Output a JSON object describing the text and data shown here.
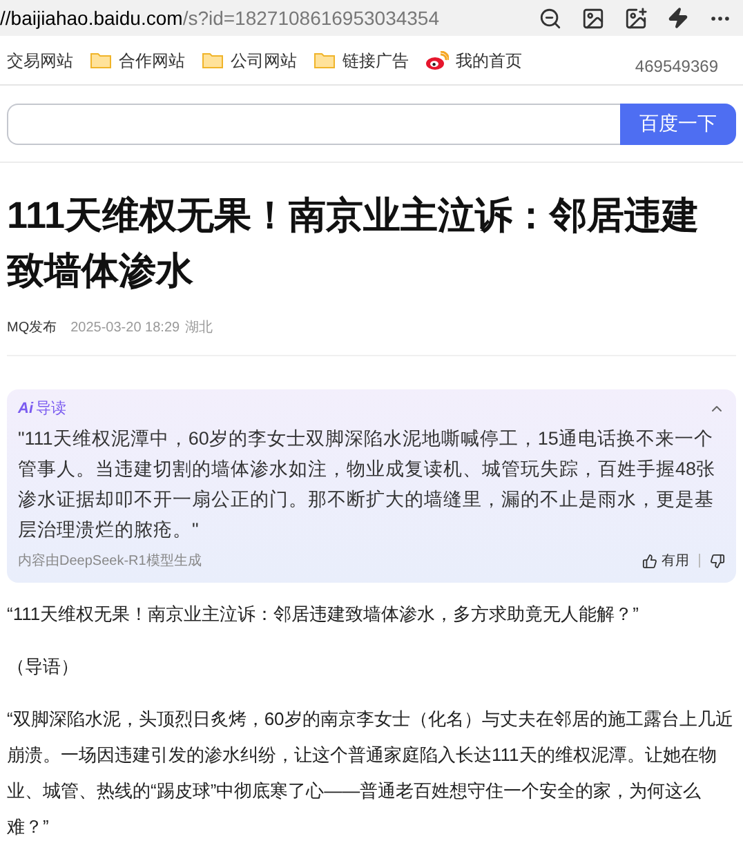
{
  "address_bar": {
    "url_host": "//baijiahao.baidu.com",
    "url_path": "/s?id=1827108616953034354"
  },
  "bookmarks": [
    {
      "kind": "text",
      "label": "交易网站"
    },
    {
      "kind": "folder",
      "label": "合作网站"
    },
    {
      "kind": "folder",
      "label": "公司网站"
    },
    {
      "kind": "folder",
      "label": "链接广告"
    },
    {
      "kind": "weibo",
      "label": "我的首页"
    }
  ],
  "bookmark_counter": "469549369",
  "search": {
    "button": "百度一下"
  },
  "article": {
    "title": "111天维权无果！南京业主泣诉：邻居违建致墙体渗水",
    "author": "MQ发布",
    "date": "2025-03-20 18:29",
    "location": "湖北"
  },
  "ai_summary": {
    "badge": "Ai",
    "label": "导读",
    "expanded": true,
    "text": "\"111天维权泥潭中，60岁的李女士双脚深陷水泥地嘶喊停工，15通电话换不来一个管事人。当违建切割的墙体渗水如注，物业成复读机、城管玩失踪，百姓手握48张渗水证据却叩不开一扇公正的门。那不断扩大的墙缝里，漏的不止是雨水，更是基层治理溃烂的脓疮。\"",
    "source": "内容由DeepSeek-R1模型生成",
    "useful": "有用"
  },
  "paragraphs": [
    "“111天维权无果！南京业主泣诉：邻居违建致墙体渗水，多方求助竟无人能解？”",
    "（导语）",
    "“双脚深陷水泥，头顶烈日炙烤，60岁的南京李女士（化名）与丈夫在邻居的施工露台上几近崩溃。一场因违建引发的渗水纠纷，让这个普通家庭陷入长达111天的维权泥潭。让她在物业、城管、热线的“踢皮球”中彻底寒了心——普通老百姓想守住一个安全的家，为何这么难？”"
  ]
}
